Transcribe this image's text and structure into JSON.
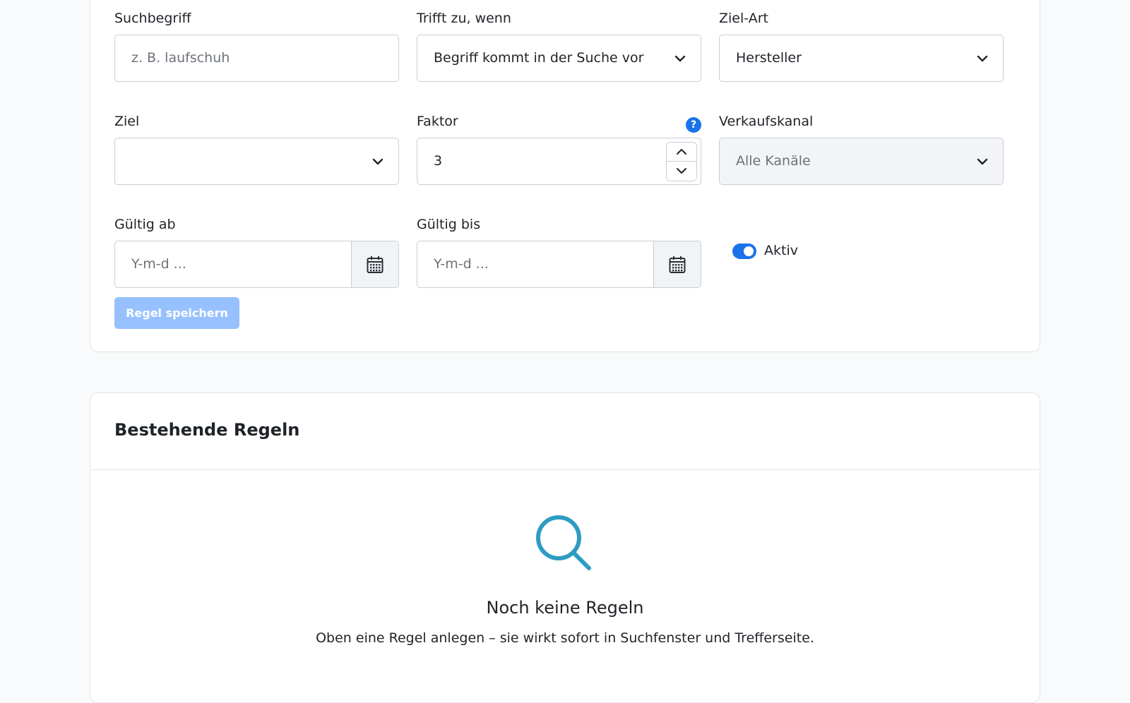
{
  "form": {
    "search_term": {
      "label": "Suchbegriff",
      "placeholder": "z. B. laufschuh"
    },
    "match": {
      "label": "Trifft zu, wenn",
      "value": "Begriff kommt in der Suche vor"
    },
    "target_type": {
      "label": "Ziel-Art",
      "value": "Hersteller"
    },
    "target": {
      "label": "Ziel",
      "value": ""
    },
    "factor": {
      "label": "Faktor",
      "value": "3",
      "help": "?"
    },
    "sales_channel": {
      "label": "Verkaufskanal",
      "value": "Alle Kanäle"
    },
    "valid_from": {
      "label": "Gültig ab",
      "placeholder": "Y-m-d ..."
    },
    "valid_to": {
      "label": "Gültig bis",
      "placeholder": "Y-m-d ..."
    },
    "active": {
      "label": "Aktiv",
      "checked": true
    },
    "save_label": "Regel speichern"
  },
  "rules": {
    "title": "Bestehende Regeln",
    "empty_title": "Noch keine Regeln",
    "empty_text": "Oben eine Regel anlegen – sie wirkt sofort in Suchfenster und Trefferseite."
  },
  "colors": {
    "accent": "#1a73e8",
    "button_disabled": "#86b7fe",
    "empty_icon": "#2e9cc2"
  },
  "icons": {
    "chevron": "chevron-down-icon",
    "calendar": "calendar-icon",
    "help": "help-icon",
    "empty": "search-icon"
  }
}
